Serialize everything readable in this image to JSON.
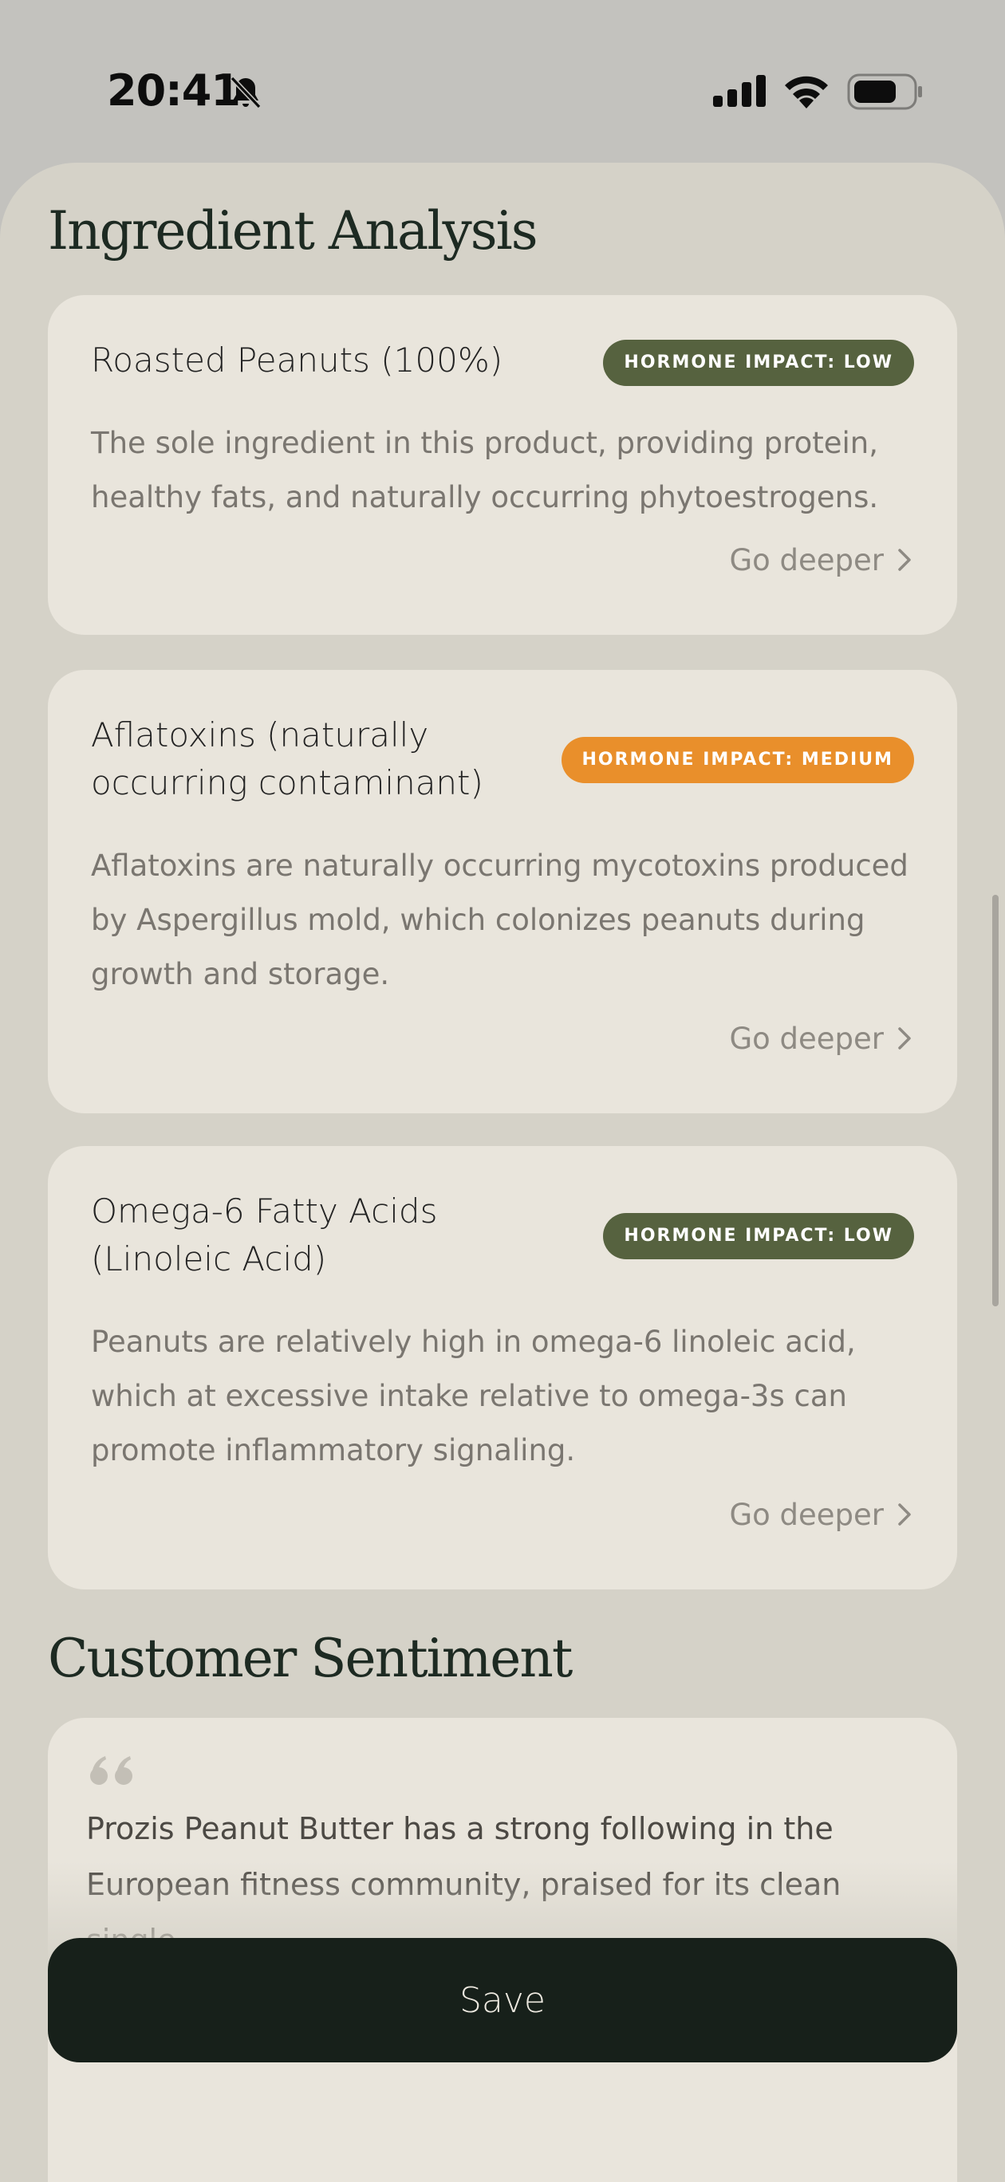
{
  "status_bar": {
    "time": "20:41",
    "icons": [
      "bell-slash-icon",
      "cellular-signal-icon",
      "wifi-icon",
      "battery-icon"
    ]
  },
  "colors": {
    "background": "#d5d2c8",
    "card": "#e9e5dc",
    "badge_low": "#56623f",
    "badge_medium": "#e98f2b",
    "button": "#17201a"
  },
  "ingredient_analysis": {
    "title": "Ingredient Analysis",
    "items": [
      {
        "name": "Roasted Peanuts (100%)",
        "badge": "HORMONE IMPACT: LOW",
        "level": "low",
        "description": "The sole ingredient in this product, providing protein, healthy fats, and naturally occurring phytoestrogens.",
        "link_label": "Go deeper"
      },
      {
        "name": "Aflatoxins (naturally occurring contaminant)",
        "badge": "HORMONE IMPACT: MEDIUM",
        "level": "medium",
        "description": "Aflatoxins are naturally occurring mycotoxins produced by Aspergillus mold, which colonizes peanuts during growth and storage.",
        "link_label": "Go deeper"
      },
      {
        "name": "Omega-6 Fatty Acids (Linoleic Acid)",
        "badge": "HORMONE IMPACT: LOW",
        "level": "low",
        "description": "Peanuts are relatively high in omega-6 linoleic acid, which at excessive intake relative to omega-3s can promote inflammatory signaling.",
        "link_label": "Go deeper"
      }
    ]
  },
  "customer_sentiment": {
    "title": "Customer Sentiment",
    "quote": "Prozis Peanut Butter has a strong following in the European fitness community, praised for its clean single-"
  },
  "save_button": {
    "label": "Save"
  }
}
